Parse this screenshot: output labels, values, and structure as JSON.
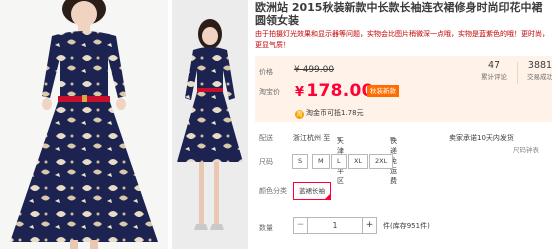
{
  "product": {
    "title": "欧洲站 2015秋装新款中长款长袖连衣裙修身时尚印花中裙圆领女装",
    "subtitle": "由于拍摄灯光效果和显示器等问题，实物会比图片稍微深一点哦，实物是蓝紫色的哦！更时尚，更显气质！"
  },
  "price": {
    "label": "价格",
    "original": "¥ 499.00",
    "promo_label": "淘宝价",
    "promo_currency": "¥",
    "promo_value": "178.00",
    "promo_badge": "秋装新款",
    "coin_icon": "淘",
    "coin_text": "淘金币可抵1.78元"
  },
  "stats": [
    {
      "value": "47",
      "label": "累计评论"
    },
    {
      "value": "3881",
      "label": "交易成功"
    }
  ],
  "shipping": {
    "label": "配送",
    "from": "浙江杭州 至",
    "to": "天津和平区",
    "express": "快递 免运费",
    "promise": "卖家承诺10天内发货",
    "more": "尺码钟表"
  },
  "sizes": {
    "label": "尺码",
    "options": [
      "S",
      "M",
      "L",
      "XL",
      "2XL"
    ]
  },
  "color": {
    "label": "颜色分类",
    "selected": "蓝裙长袖"
  },
  "quantity": {
    "label": "数量",
    "value": "1",
    "minus": "−",
    "plus": "+",
    "stock": "件(库存951件)"
  },
  "colors": {
    "accent": "#ff0036",
    "price_bg": "#fff2e8",
    "dress_navy": "#1c2350",
    "belt_red": "#c8102e"
  }
}
